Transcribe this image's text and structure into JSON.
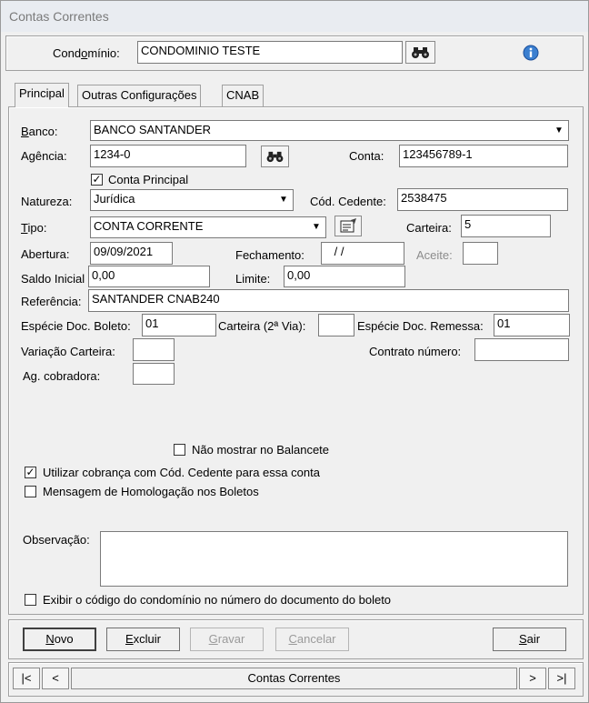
{
  "window": {
    "title": "Contas Correntes"
  },
  "header": {
    "condominio_label_pre": "Cond",
    "condominio_label_u": "o",
    "condominio_label_post": "mínio:",
    "condominio_value": "CONDOMINIO TESTE"
  },
  "tabs": [
    {
      "label": "Principal"
    },
    {
      "label": "Outras Configurações"
    },
    {
      "label": "CNAB"
    }
  ],
  "form": {
    "banco": {
      "label_u": "B",
      "label_rest": "anco:",
      "value": "BANCO SANTANDER"
    },
    "agencia": {
      "label": "Agência:",
      "value": "1234-0"
    },
    "conta": {
      "label": "Conta:",
      "value": "123456789-1"
    },
    "conta_principal": {
      "label": "Conta Principal",
      "checked": true
    },
    "natureza": {
      "label": "Natureza:",
      "value": "Jurídica"
    },
    "cod_cedente": {
      "label": "Cód. Cedente:",
      "value": "2538475"
    },
    "tipo": {
      "label_u": "T",
      "label_rest": "ipo:",
      "value": "CONTA CORRENTE"
    },
    "carteira": {
      "label": "Carteira:",
      "value": "5"
    },
    "abertura": {
      "label": "Abertura:",
      "value": "09/09/2021"
    },
    "fechamento": {
      "label": "Fechamento:",
      "value": " / /"
    },
    "aceite": {
      "label": "Aceite:",
      "value": ""
    },
    "saldo_inicial": {
      "label": "Saldo Inicial",
      "value": "0,00"
    },
    "limite": {
      "label": "Limite:",
      "value": "0,00"
    },
    "referencia": {
      "label": "Referência:",
      "value": "SANTANDER CNAB240"
    },
    "especie_doc_boleto": {
      "label": "Espécie Doc. Boleto:",
      "value": "01"
    },
    "carteira_2via": {
      "label": "Carteira (2ª Via):",
      "value": ""
    },
    "especie_doc_remessa": {
      "label": "Espécie Doc. Remessa:",
      "value": "01"
    },
    "variacao_carteira": {
      "label": "Variação Carteira:",
      "value": ""
    },
    "contrato_numero": {
      "label": "Contrato número:",
      "value": ""
    },
    "ag_cobradora": {
      "label": "Ag. cobradora:",
      "value": ""
    },
    "nao_mostrar_balancete": {
      "label": "Não mostrar no Balancete",
      "checked": false
    },
    "utilizar_cobranca": {
      "label": "Utilizar cobrança com Cód. Cedente para essa conta",
      "checked": true
    },
    "mensagem_homologacao": {
      "label": "Mensagem de Homologação nos Boletos",
      "checked": false
    },
    "observacao": {
      "label": "Observação:",
      "value": ""
    },
    "exibir_codigo": {
      "label": "Exibir o código do condomínio no número do documento do boleto",
      "checked": false
    }
  },
  "buttons": {
    "novo": {
      "u": "N",
      "rest": "ovo"
    },
    "excluir": {
      "u": "E",
      "rest": "xcluir"
    },
    "gravar": {
      "u": "G",
      "rest": "ravar"
    },
    "cancelar": {
      "u": "C",
      "rest": "ancelar"
    },
    "sair": {
      "u": "S",
      "rest": "air"
    }
  },
  "navigator": {
    "first": "|<",
    "prev": "<",
    "label": "Contas Correntes",
    "next": ">",
    "last": ">|"
  },
  "icons": {
    "binoculars": "binoculars-icon",
    "info": "info-icon",
    "edit": "edit-record-icon"
  }
}
